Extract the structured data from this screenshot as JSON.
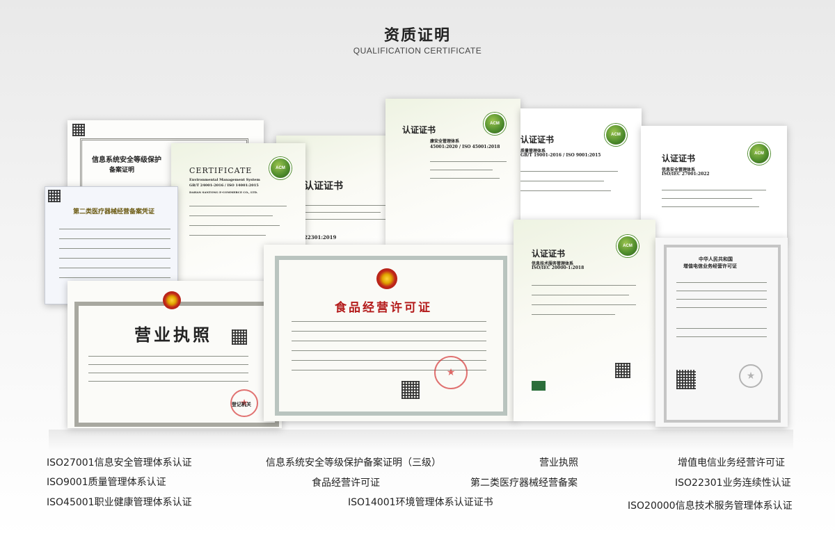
{
  "header": {
    "title": "资质证明",
    "subtitle": "QUALIFICATION CERTIFICATE"
  },
  "certificates": {
    "infosec": {
      "title_line1": "信息系统安全等级保护",
      "title_line2": "备案证明"
    },
    "env": {
      "title": "CERTIFICATE",
      "line1": "Environmental Management System",
      "line2": "GB/T 24001-2016 / ISO 14001:2015",
      "company": "DAHAN SANTONG E-COMMERCE CO., LTD."
    },
    "center": {
      "title": "认证证书",
      "line": "22301:2019"
    },
    "ohs": {
      "title": "认证证书",
      "line1": "康安全管理体系",
      "line2": "45001:2020 / ISO 45001:2018"
    },
    "quality": {
      "title": "认证证书",
      "line1": "质量管理体系",
      "line2": "GB/T 19001-2016 / ISO 9001:2015"
    },
    "isms": {
      "title": "认证证书",
      "line1": "信息安全管理体系",
      "line2": "ISO/IEC 27001:2022"
    },
    "medical": {
      "title": "第二类医疗器械经营备案凭证"
    },
    "business": {
      "title": "营业执照",
      "footer": "登记机关"
    },
    "food": {
      "title": "食品经营许可证"
    },
    "itsm": {
      "title": "认证证书",
      "line1": "信息技术服务管理体系",
      "line2": "ISO/IEC 20000-1:2018"
    },
    "telecom": {
      "line1": "中华人民共和国",
      "line2": "增值电信业务经营许可证"
    }
  },
  "labels": {
    "iso27001": "ISO27001信息安全管理体系认证",
    "iso9001": "ISO9001质量管理体系认证",
    "iso45001": "ISO45001职业健康管理体系认证",
    "infosec": "信息系统安全等级保护备案证明（三级）",
    "food": "食品经营许可证",
    "iso14001": "ISO14001环境管理体系认证证书",
    "business": "营业执照",
    "medical": "第二类医疗器械经营备案",
    "telecom": "增值电信业务经营许可证",
    "iso22301": "ISO22301业务连续性认证",
    "iso20000": "ISO20000信息技术服务管理体系认证"
  },
  "colors": {
    "accent_green": "#4d8b2c",
    "stamp_red": "#d22828"
  }
}
